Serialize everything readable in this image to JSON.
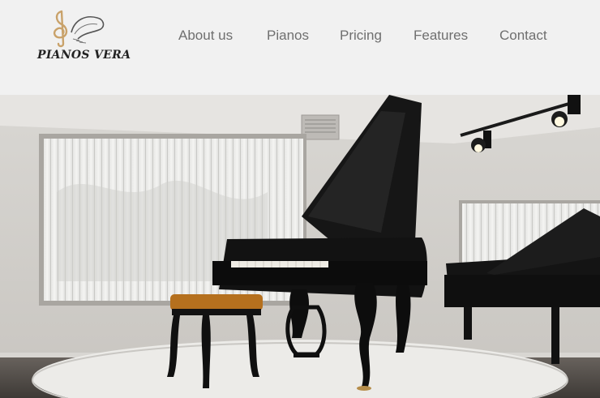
{
  "brand": {
    "name": "PIANOS VERA",
    "logo_icon": "treble-clef-icon",
    "accent_color": "#c9a26a"
  },
  "nav": {
    "items": [
      {
        "label": "About us"
      },
      {
        "label": "Pianos"
      },
      {
        "label": "Pricing"
      },
      {
        "label": "Features"
      },
      {
        "label": "Contact"
      }
    ]
  },
  "hero": {
    "image": "grand-piano-showroom-photo"
  }
}
